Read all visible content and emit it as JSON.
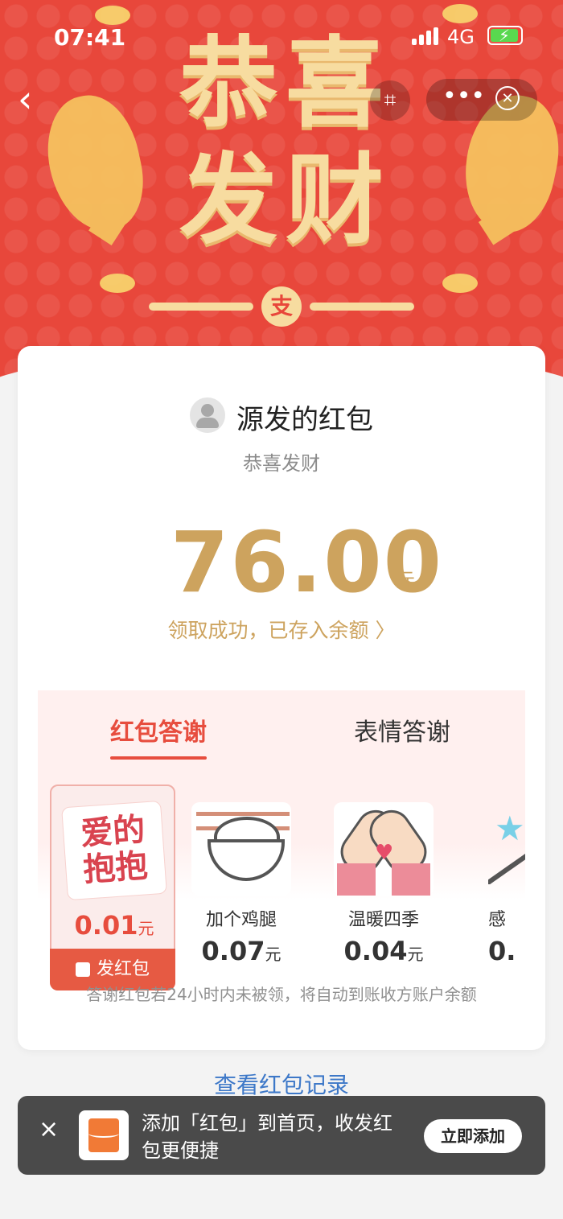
{
  "status_bar": {
    "time": "07:41",
    "network": "4G"
  },
  "header": {
    "title": "恭喜\n发财",
    "badge_char": "支",
    "icons": [
      "back-icon",
      "scan-icon",
      "more-icon",
      "close-icon"
    ]
  },
  "red_packet": {
    "sender_name": "源发的红包",
    "subtitle": "恭喜发财",
    "amount": "76.00",
    "unit": "元",
    "status": "领取成功，已存入余额 〉"
  },
  "thanks_section": {
    "tabs": [
      {
        "label": "红包答谢",
        "active": true
      },
      {
        "label": "表情答谢",
        "active": false
      }
    ],
    "items": [
      {
        "art_text": "爱的\n抱抱",
        "price": "0.01",
        "unit": "元",
        "selected": true,
        "action_label": "发红包"
      },
      {
        "name": "加个鸡腿",
        "price": "0.07",
        "unit": "元"
      },
      {
        "name": "温暖四季",
        "price": "0.04",
        "unit": "元"
      },
      {
        "name": "感",
        "price": "0."
      }
    ],
    "footnote": "答谢红包若24小时内未被领，将自动到账收方账户余额"
  },
  "record_link": "查看红包记录",
  "toast": {
    "text": "添加「红包」到首页，收发红包更便捷",
    "button": "立即添加"
  },
  "colors": {
    "hero": "#e8473b",
    "gold": "#cda35e",
    "accent": "#e74d3e",
    "link": "#3d78c8"
  }
}
